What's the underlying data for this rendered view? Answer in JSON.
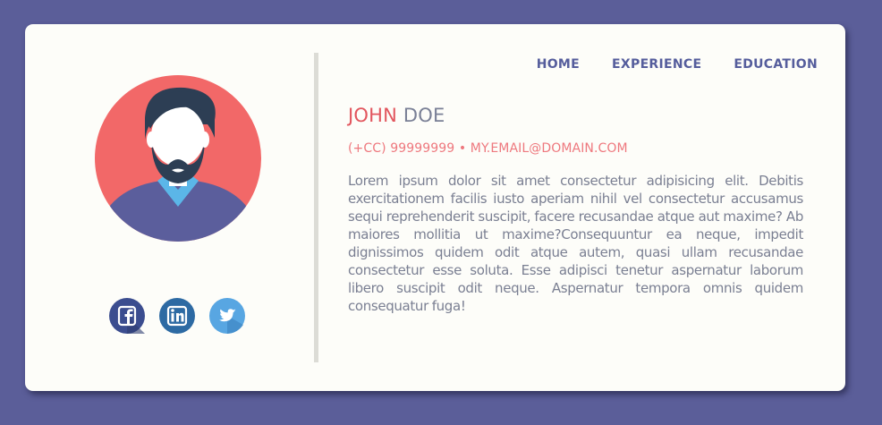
{
  "nav": {
    "home_label": "HOME",
    "experience_label": "EXPERIENCE",
    "education_label": "EDUCATION"
  },
  "profile": {
    "first_name": "JOHN",
    "last_name": "DOE",
    "contact": "(+CC) 99999999 • MY.EMAIL@DOMAIN.COM",
    "bio": "Lorem ipsum dolor sit amet consectetur adipisicing elit. Debitis exercitationem facilis iusto aperiam nihil vel consectetur accusamus sequi reprehenderit suscipit, facere recusandae atque aut maxime? Ab maiores mollitia ut maxime?Consequuntur ea neque, impedit dignissimos quidem odit atque autem, quasi ullam recusandae consectetur esse soluta. Esse adipisci tenetur aspernatur laborum libero suscipit odit neque. Aspernatur tempora omnis quidem consequatur fuga!"
  },
  "socials": [
    {
      "name": "facebook",
      "icon": "facebook-icon",
      "color": "#3b4d8f"
    },
    {
      "name": "linkedin",
      "icon": "linkedin-icon",
      "color": "#2d6aa3"
    },
    {
      "name": "twitter",
      "icon": "twitter-icon",
      "color": "#58a6e2"
    }
  ],
  "colors": {
    "background": "#5b5e99",
    "card": "#fdfdf9",
    "avatar_bg": "#f26868",
    "nav": "#555d9c",
    "first_name": "#e2565e",
    "contact": "#ee787e",
    "text": "#7a7f92"
  }
}
